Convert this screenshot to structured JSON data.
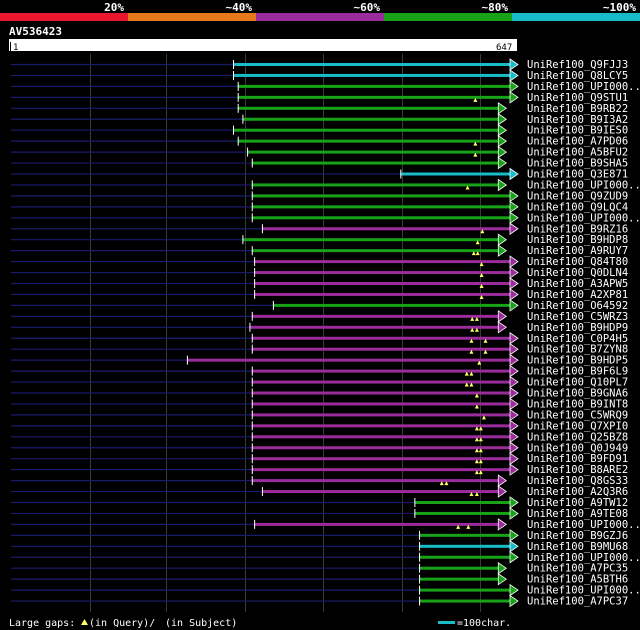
{
  "chart_data": {
    "type": "bar",
    "title": "AV536423",
    "query_length": 647,
    "scale": {
      "start": "1",
      "end": "647"
    },
    "legend": [
      {
        "label": "20%",
        "color": "#e8172f"
      },
      {
        "label": "~40%",
        "color": "#e8781c"
      },
      {
        "label": "~60%",
        "color": "#9b2c9b"
      },
      {
        "label": "~80%",
        "color": "#17a217"
      },
      {
        "label": "~100%",
        "color": "#17bcc8"
      }
    ],
    "identity_colors": {
      "cyan": "#17bcc8",
      "green": "#17a217",
      "purple": "#9b2c9b"
    },
    "series": [
      {
        "name": "UniRef100_Q9FJJ3",
        "color": "cyan",
        "start": 285,
        "end": 647,
        "arrow": true,
        "gaps": []
      },
      {
        "name": "UniRef100_Q8LCY5",
        "color": "cyan",
        "start": 285,
        "end": 647,
        "arrow": true,
        "gaps": []
      },
      {
        "name": "UniRef100_UPI000..",
        "color": "green",
        "start": 291,
        "end": 647,
        "arrow": true,
        "gaps": []
      },
      {
        "name": "UniRef100_Q9STU1",
        "color": "green",
        "start": 291,
        "end": 647,
        "arrow": true,
        "gaps": [
          {
            "pos": 595,
            "type": "query"
          }
        ]
      },
      {
        "name": "UniRef100_B9RB22",
        "color": "green",
        "start": 291,
        "end": 632,
        "arrow": true,
        "gaps": []
      },
      {
        "name": "UniRef100_B9I3A2",
        "color": "green",
        "start": 297,
        "end": 632,
        "arrow": true,
        "gaps": []
      },
      {
        "name": "UniRef100_B9IES0",
        "color": "green",
        "start": 285,
        "end": 632,
        "arrow": true,
        "gaps": []
      },
      {
        "name": "UniRef100_A7PD06",
        "color": "green",
        "start": 291,
        "end": 632,
        "arrow": true,
        "gaps": [
          {
            "pos": 595,
            "type": "query"
          }
        ]
      },
      {
        "name": "UniRef100_A5BFU2",
        "color": "green",
        "start": 303,
        "end": 632,
        "arrow": true,
        "gaps": [
          {
            "pos": 595,
            "type": "query"
          }
        ]
      },
      {
        "name": "UniRef100_B9SHA5",
        "color": "green",
        "start": 309,
        "end": 632,
        "arrow": true,
        "gaps": []
      },
      {
        "name": "UniRef100_Q3E871",
        "color": "cyan",
        "start": 499,
        "end": 647,
        "arrow": true,
        "gaps": []
      },
      {
        "name": "UniRef100_UPI000..",
        "color": "green",
        "start": 309,
        "end": 632,
        "arrow": true,
        "gaps": [
          {
            "pos": 585,
            "type": "query"
          }
        ]
      },
      {
        "name": "UniRef100_Q9ZUD9",
        "color": "green",
        "start": 309,
        "end": 647,
        "arrow": true,
        "gaps": []
      },
      {
        "name": "UniRef100_Q9LQC4",
        "color": "green",
        "start": 309,
        "end": 647,
        "arrow": true,
        "gaps": []
      },
      {
        "name": "UniRef100_UPI000..",
        "color": "green",
        "start": 309,
        "end": 647,
        "arrow": true,
        "gaps": []
      },
      {
        "name": "UniRef100_B9RZ16",
        "color": "purple",
        "start": 322,
        "end": 647,
        "arrow": true,
        "gaps": [
          {
            "pos": 604,
            "type": "query"
          }
        ]
      },
      {
        "name": "UniRef100_B9HDP8",
        "color": "green",
        "start": 297,
        "end": 632,
        "arrow": true,
        "gaps": [
          {
            "pos": 598,
            "type": "query"
          }
        ]
      },
      {
        "name": "UniRef100_A9RUY7",
        "color": "green",
        "start": 309,
        "end": 632,
        "arrow": true,
        "gaps": [
          {
            "pos": 593,
            "type": "query"
          },
          {
            "pos": 598,
            "type": "query"
          }
        ]
      },
      {
        "name": "UniRef100_Q84T80",
        "color": "purple",
        "start": 312,
        "end": 647,
        "arrow": true,
        "gaps": [
          {
            "pos": 603,
            "type": "query"
          }
        ]
      },
      {
        "name": "UniRef100_Q0DLN4",
        "color": "purple",
        "start": 312,
        "end": 647,
        "arrow": true,
        "gaps": [
          {
            "pos": 603,
            "type": "query"
          }
        ]
      },
      {
        "name": "UniRef100_A3APW5",
        "color": "purple",
        "start": 312,
        "end": 647,
        "arrow": true,
        "gaps": [
          {
            "pos": 603,
            "type": "query"
          }
        ]
      },
      {
        "name": "UniRef100_A2XP81",
        "color": "purple",
        "start": 312,
        "end": 647,
        "arrow": true,
        "gaps": [
          {
            "pos": 603,
            "type": "query"
          }
        ]
      },
      {
        "name": "UniRef100_O64592",
        "color": "green",
        "start": 336,
        "end": 647,
        "arrow": true,
        "gaps": []
      },
      {
        "name": "UniRef100_C5WRZ3",
        "color": "purple",
        "start": 309,
        "end": 632,
        "arrow": true,
        "gaps": [
          {
            "pos": 591,
            "type": "query"
          },
          {
            "pos": 597,
            "type": "query"
          }
        ]
      },
      {
        "name": "UniRef100_B9HDP9",
        "color": "purple",
        "start": 306,
        "end": 632,
        "arrow": true,
        "gaps": [
          {
            "pos": 591,
            "type": "query"
          },
          {
            "pos": 597,
            "type": "query"
          }
        ]
      },
      {
        "name": "UniRef100_C0P4H5",
        "color": "purple",
        "start": 309,
        "end": 647,
        "arrow": true,
        "gaps": [
          {
            "pos": 590,
            "type": "query"
          },
          {
            "pos": 608,
            "type": "query"
          }
        ]
      },
      {
        "name": "UniRef100_B7ZYN8",
        "color": "purple",
        "start": 309,
        "end": 647,
        "arrow": true,
        "gaps": [
          {
            "pos": 590,
            "type": "query"
          },
          {
            "pos": 608,
            "type": "query"
          }
        ]
      },
      {
        "name": "UniRef100_B9HDP5",
        "color": "purple",
        "start": 226,
        "end": 647,
        "arrow": true,
        "gaps": [
          {
            "pos": 600,
            "type": "query"
          }
        ]
      },
      {
        "name": "UniRef100_B9F6L9",
        "color": "purple",
        "start": 309,
        "end": 647,
        "arrow": true,
        "gaps": [
          {
            "pos": 584,
            "type": "query"
          },
          {
            "pos": 590,
            "type": "query"
          }
        ]
      },
      {
        "name": "UniRef100_Q10PL7",
        "color": "purple",
        "start": 309,
        "end": 647,
        "arrow": true,
        "gaps": [
          {
            "pos": 584,
            "type": "query"
          },
          {
            "pos": 590,
            "type": "query"
          }
        ]
      },
      {
        "name": "UniRef100_B9GNA6",
        "color": "purple",
        "start": 309,
        "end": 647,
        "arrow": true,
        "gaps": [
          {
            "pos": 597,
            "type": "query"
          }
        ]
      },
      {
        "name": "UniRef100_B9INT8",
        "color": "purple",
        "start": 309,
        "end": 647,
        "arrow": true,
        "gaps": [
          {
            "pos": 597,
            "type": "query"
          }
        ]
      },
      {
        "name": "UniRef100_C5WRQ9",
        "color": "purple",
        "start": 309,
        "end": 647,
        "arrow": true,
        "gaps": [
          {
            "pos": 606,
            "type": "query"
          }
        ]
      },
      {
        "name": "UniRef100_Q7XPI0",
        "color": "purple",
        "start": 309,
        "end": 647,
        "arrow": true,
        "gaps": [
          {
            "pos": 597,
            "type": "query"
          },
          {
            "pos": 602,
            "type": "query"
          }
        ]
      },
      {
        "name": "UniRef100_Q25BZ8",
        "color": "purple",
        "start": 309,
        "end": 647,
        "arrow": true,
        "gaps": [
          {
            "pos": 597,
            "type": "query"
          },
          {
            "pos": 602,
            "type": "query"
          }
        ]
      },
      {
        "name": "UniRef100_Q0J949",
        "color": "purple",
        "start": 309,
        "end": 647,
        "arrow": true,
        "gaps": [
          {
            "pos": 597,
            "type": "query"
          },
          {
            "pos": 602,
            "type": "query"
          }
        ]
      },
      {
        "name": "UniRef100_B9FD91",
        "color": "purple",
        "start": 309,
        "end": 647,
        "arrow": true,
        "gaps": [
          {
            "pos": 597,
            "type": "query"
          },
          {
            "pos": 602,
            "type": "query"
          }
        ]
      },
      {
        "name": "UniRef100_B8ARE2",
        "color": "purple",
        "start": 309,
        "end": 647,
        "arrow": true,
        "gaps": [
          {
            "pos": 597,
            "type": "query"
          },
          {
            "pos": 602,
            "type": "query"
          }
        ]
      },
      {
        "name": "UniRef100_Q8GS33",
        "color": "purple",
        "start": 309,
        "end": 632,
        "arrow": true,
        "gaps": [
          {
            "pos": 552,
            "type": "query"
          },
          {
            "pos": 558,
            "type": "query"
          }
        ]
      },
      {
        "name": "UniRef100_A2Q3R6",
        "color": "purple",
        "start": 322,
        "end": 632,
        "arrow": true,
        "gaps": [
          {
            "pos": 590,
            "type": "query"
          },
          {
            "pos": 597,
            "type": "query"
          }
        ]
      },
      {
        "name": "UniRef100_A9TW12",
        "color": "green",
        "start": 517,
        "end": 647,
        "arrow": true,
        "gaps": []
      },
      {
        "name": "UniRef100_A9TE08",
        "color": "green",
        "start": 517,
        "end": 647,
        "arrow": true,
        "gaps": []
      },
      {
        "name": "UniRef100_UPI000..",
        "color": "purple",
        "start": 312,
        "end": 632,
        "arrow": true,
        "gaps": [
          {
            "pos": 573,
            "type": "query"
          },
          {
            "pos": 586,
            "type": "query"
          }
        ]
      },
      {
        "name": "UniRef100_B9GZJ6",
        "color": "green",
        "start": 523,
        "end": 647,
        "arrow": true,
        "gaps": []
      },
      {
        "name": "UniRef100_B9MU68",
        "color": "cyan",
        "start": 523,
        "end": 647,
        "arrow": true,
        "gaps": []
      },
      {
        "name": "UniRef100_UPI000..",
        "color": "green",
        "start": 523,
        "end": 647,
        "arrow": true,
        "gaps": []
      },
      {
        "name": "UniRef100_A7PC35",
        "color": "green",
        "start": 523,
        "end": 632,
        "arrow": true,
        "gaps": []
      },
      {
        "name": "UniRef100_A5BTH6",
        "color": "green",
        "start": 523,
        "end": 632,
        "arrow": true,
        "gaps": []
      },
      {
        "name": "UniRef100_UPI000..",
        "color": "green",
        "start": 523,
        "end": 647,
        "arrow": true,
        "gaps": []
      },
      {
        "name": "UniRef100_A7PC37",
        "color": "green",
        "start": 523,
        "end": 647,
        "arrow": true,
        "gaps": []
      }
    ],
    "footer": {
      "gaps_label": "Large gaps:",
      "query_gap_label": "(in Query)/",
      "subject_gap_label": "(in Subject)",
      "scale_label": "=100char."
    }
  }
}
